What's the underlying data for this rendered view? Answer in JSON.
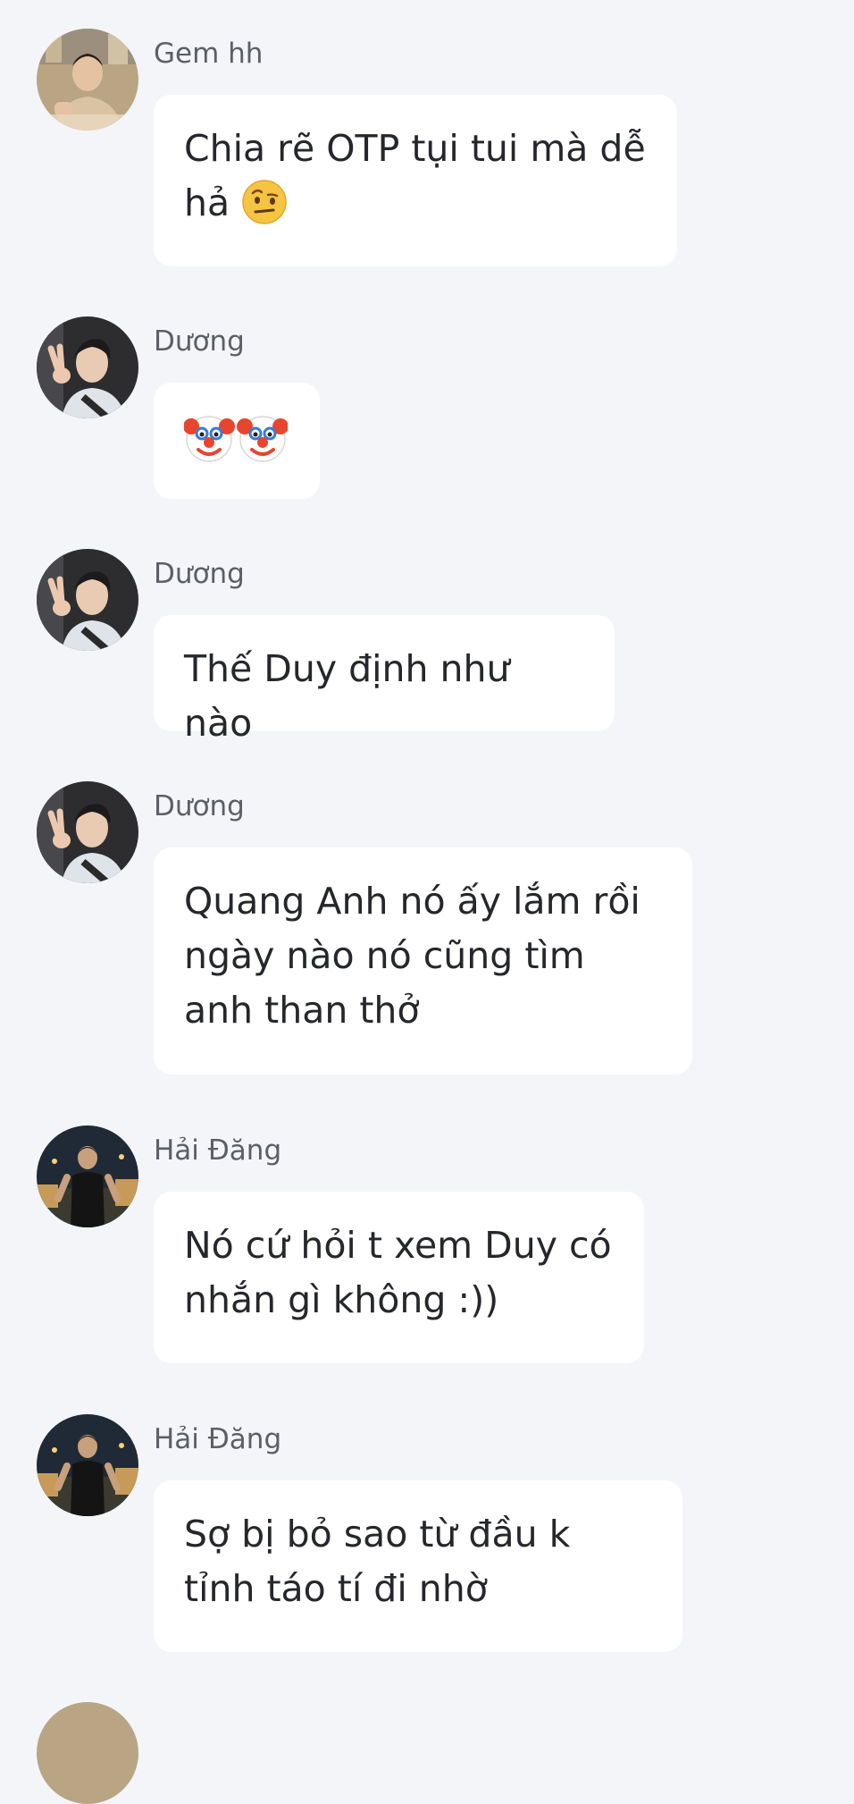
{
  "messages": [
    {
      "sender": "Gem hh",
      "text": "Chia rẽ OTP tụi tui mà dễ hả",
      "emoji": "face-with-raised-eyebrow-emoji"
    },
    {
      "sender": "Dương",
      "text": "",
      "emoji": "clown-face-emoji x2"
    },
    {
      "sender": "Dương",
      "text": "Thế Duy định như nào"
    },
    {
      "sender": "Dương",
      "text": "Quang Anh nó ấy lắm rồi ngày nào nó cũng tìm anh than thở"
    },
    {
      "sender": "Hải Đăng",
      "text": "Nó cứ hỏi t xem Duy có nhắn gì không :))"
    },
    {
      "sender": "Hải Đăng",
      "text": "Sợ bị bỏ sao từ đầu k tỉnh táo tí đi nhờ"
    }
  ],
  "colors": {
    "background": "#f4f5f9",
    "bubble": "#ffffff",
    "sender_text": "#5c5f66",
    "message_text": "#25272b"
  }
}
